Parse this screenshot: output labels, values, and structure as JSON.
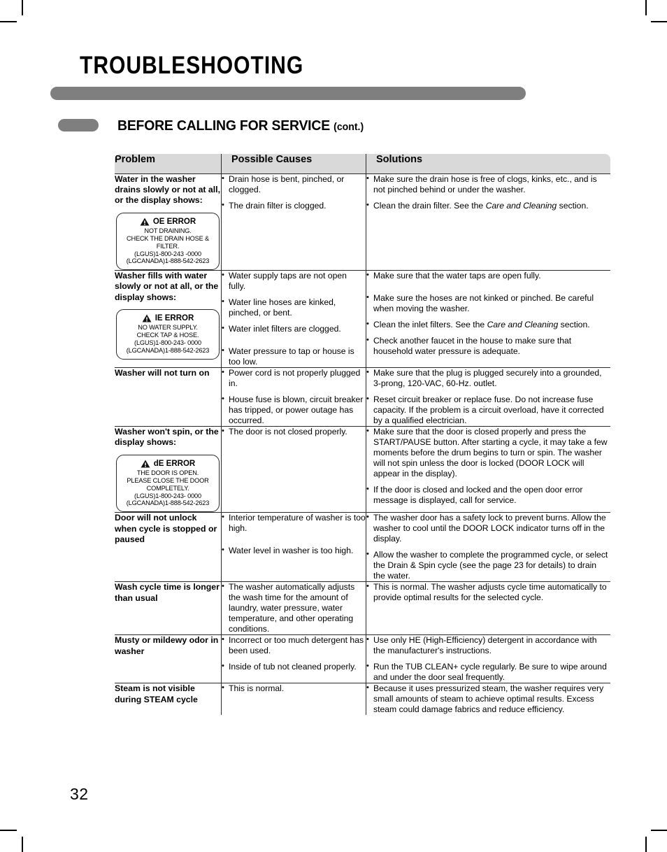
{
  "page": {
    "chapter_title": "TROUBLESHOOTING",
    "section_title": "BEFORE CALLING FOR SERVICE",
    "section_title_suffix": "(cont.)",
    "page_number": "32",
    "accent_gray": "#7f7f7f",
    "header_row_gray": "#d9d9d9"
  },
  "table": {
    "headers": {
      "problem": "Problem",
      "causes": "Possible Causes",
      "solutions": "Solutions"
    },
    "rows": [
      {
        "problem": "Water in the washer drains slowly or not at all, or the display shows:",
        "error_box": {
          "icon": "warning-triangle-icon",
          "code": "OE ERROR",
          "lines": [
            "NOT DRAINING.",
            "CHECK THE DRAIN HOSE &",
            "FILTER.",
            "(LGUS)1-800-243 -0000",
            "(LGCANADA)1-888-542-2623"
          ]
        },
        "causes": [
          {
            "text": "Drain hose is bent, pinched, or clogged."
          },
          {
            "text": "The drain filter is clogged."
          }
        ],
        "solutions": [
          {
            "text": "Make sure the drain hose is free of clogs, kinks, etc., and is not pinched behind or under the washer."
          },
          {
            "pre": "Clean the drain filter. See the ",
            "italic": "Care and Cleaning",
            "post": " section."
          }
        ]
      },
      {
        "problem": "Washer fills with water slowly or not at all, or the display shows:",
        "error_box": {
          "icon": "warning-triangle-icon",
          "code": "IE ERROR",
          "lines": [
            "NO WATER SUPPLY.",
            "CHECK TAP & HOSE.",
            "(LGUS)1-800-243- 0000",
            "(LGCANADA)1-888-542-2623"
          ]
        },
        "causes": [
          {
            "text": "Water supply taps are not open fully."
          },
          {
            "text": "Water line hoses are kinked, pinched, or bent."
          },
          {
            "text": "Water inlet filters are clogged."
          },
          {
            "text": "Water pressure to tap or house is too low.",
            "gap": true
          }
        ],
        "solutions": [
          {
            "text": "Make sure that the water taps are open fully."
          },
          {
            "text": "Make sure the hoses are not kinked or pinched. Be careful when moving the washer.",
            "gap": true
          },
          {
            "pre": "Clean the inlet filters. See the ",
            "italic": "Care and Cleaning",
            "post": " section."
          },
          {
            "text": "Check another faucet in the house to make sure that household water pressure is adequate."
          }
        ]
      },
      {
        "problem": "Washer will not turn on",
        "causes": [
          {
            "text": "Power cord is not properly plugged in."
          },
          {
            "text": "House fuse is blown, circuit breaker has tripped, or power outage has occurred."
          }
        ],
        "solutions": [
          {
            "text": "Make sure that the plug is plugged securely into a grounded, 3-prong, 120-VAC, 60-Hz. outlet."
          },
          {
            "text": "Reset circuit breaker or replace fuse. Do not increase fuse capacity. If the problem is a circuit overload, have it corrected by a qualified electrician."
          }
        ]
      },
      {
        "problem": "Washer won't spin, or the display shows:",
        "error_box": {
          "icon": "warning-triangle-icon",
          "code": "dE ERROR",
          "lines": [
            "THE DOOR IS OPEN.",
            "PLEASE CLOSE THE DOOR",
            "COMPLETELY.",
            "(LGUS)1-800-243- 0000",
            "(LGCANADA)1-888-542-2623"
          ]
        },
        "causes": [
          {
            "text": "The door is not closed properly."
          }
        ],
        "solutions": [
          {
            "text": "Make sure that the door is closed properly and press the START/PAUSE button. After starting a cycle, it may take a few moments before the drum begins to turn or spin. The washer will not spin unless the door is locked (DOOR LOCK will appear in the display)."
          },
          {
            "text": "If the door is closed and locked and the open door error message is displayed, call for service."
          }
        ]
      },
      {
        "problem": "Door will not unlock when cycle is stopped or paused",
        "causes": [
          {
            "text": "Interior temperature of washer is too high."
          },
          {
            "text": "Water level in washer is too high.",
            "gap": true
          }
        ],
        "solutions": [
          {
            "text": "The washer door has a safety lock to prevent burns. Allow the washer to cool until the DOOR LOCK indicator turns off in the display."
          },
          {
            "text": "Allow the washer to complete the programmed cycle, or select the Drain & Spin cycle (see the page 23 for details) to drain the water."
          }
        ]
      },
      {
        "problem": "Wash cycle time is longer than usual",
        "causes": [
          {
            "text": "The washer automatically adjusts the wash time for the amount of laundry, water pressure, water temperature, and other operating conditions."
          }
        ],
        "solutions": [
          {
            "text": "This is normal. The washer adjusts cycle time automatically to provide optimal results for the selected cycle."
          }
        ]
      },
      {
        "problem": "Musty or mildewy odor in washer",
        "causes": [
          {
            "text": "Incorrect or too much detergent has been used."
          },
          {
            "text": "Inside of tub not cleaned properly."
          }
        ],
        "solutions": [
          {
            "text": "Use only HE (High-Efficiency) detergent in accordance with the manufacturer's instructions."
          },
          {
            "text": "Run the TUB CLEAN+ cycle regularly. Be sure to wipe around and under the door seal frequently."
          }
        ]
      },
      {
        "problem": "Steam is not visible during STEAM cycle",
        "causes": [
          {
            "text": "This is normal."
          }
        ],
        "solutions": [
          {
            "text": "Because it uses pressurized steam, the washer requires very small amounts of steam to achieve optimal results. Excess steam could damage fabrics and reduce efficiency."
          }
        ]
      }
    ]
  }
}
